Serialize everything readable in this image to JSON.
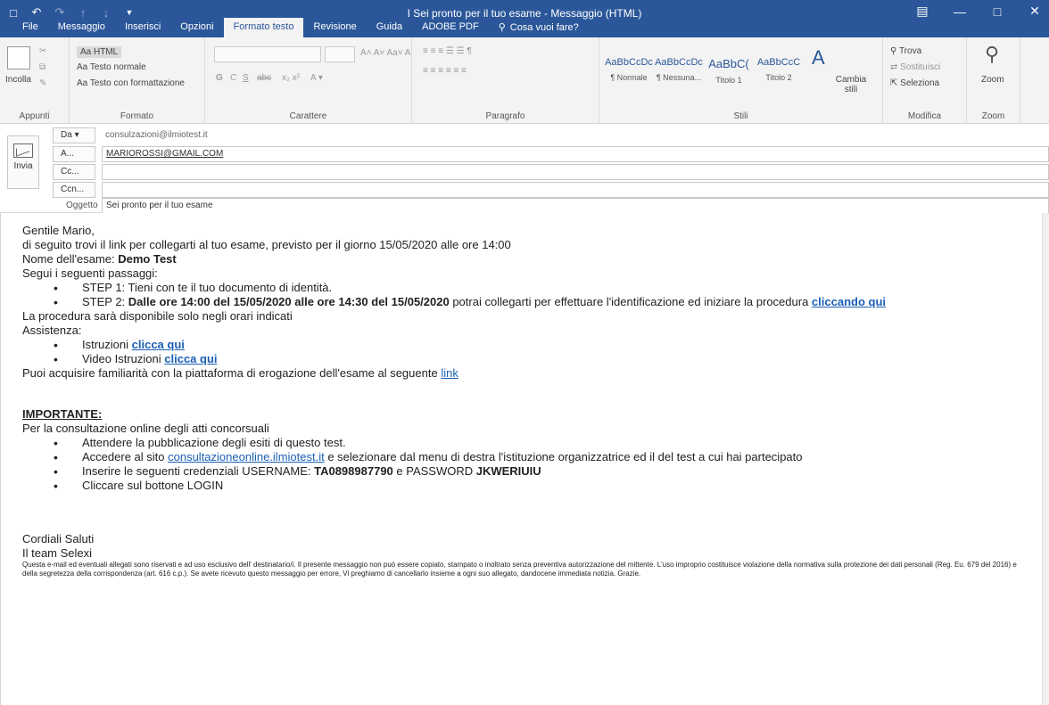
{
  "window": {
    "title": "I Sei pronto per il tuo esame - Messaggio (HTML)"
  },
  "ribbon": {
    "tabs": [
      "File",
      "Messaggio",
      "Inserisci",
      "Opzioni",
      "Formato testo",
      "Revisione",
      "Guida",
      "ADOBE PDF",
      "Cosa vuoi fare?"
    ],
    "active_tab": "Formato testo",
    "groups": {
      "appunti": {
        "label": "Appunti",
        "incolla": "Incolla"
      },
      "formato": {
        "label": "Formato",
        "html": "Aa HTML",
        "testo_normale": "Aa Testo normale",
        "testo_formattazione": "Aa Testo con formattazione"
      },
      "carattere": {
        "label": "Carattere"
      },
      "paragrafo": {
        "label": "Paragrafo"
      },
      "stili": {
        "label": "Stili",
        "items": [
          {
            "sample": "AaBbCcDc",
            "name": "¶ Normale"
          },
          {
            "sample": "AaBbCcDc",
            "name": "¶ Nessuna..."
          },
          {
            "sample": "AaBbC(",
            "name": "Titolo 1"
          },
          {
            "sample": "AaBbCcC",
            "name": "Titolo 2"
          }
        ],
        "cambia_stili": "Cambia stili"
      },
      "modifica": {
        "label": "Modifica",
        "trova": "Trova",
        "sostituisci": "Sostituisci",
        "seleziona": "Seleziona"
      },
      "zoom": {
        "label": "Zoom",
        "zoom_btn": "Zoom"
      }
    }
  },
  "header": {
    "send": "Invia",
    "da_label": "Da",
    "da_value": "consulzazioni@ilmiotest.it",
    "a_label": "A...",
    "a_value": "MARIOROSSI@GMAIL.COM",
    "cc_label": "Cc...",
    "ccn_label": "Ccn...",
    "subject_label": "Oggetto",
    "subject_value": "Sei pronto per il tuo esame"
  },
  "body": {
    "greeting": "Gentile Mario,",
    "intro": "di seguito trovi il link per collegarti al tuo esame, previsto per il giorno 15/05/2020 alle ore 14:00",
    "exam_label": "Nome dell'esame: ",
    "exam_name": "Demo Test",
    "steps_intro": "Segui i seguenti passaggi:",
    "step1": "STEP 1: Tieni con te il tuo documento di identità.",
    "step2_prefix": "STEP 2: ",
    "step2_bold": "Dalle ore 14:00 del 15/05/2020 alle ore 14:30 del 15/05/2020",
    "step2_rest": " potrai collegarti per effettuare l'identificazione ed iniziare la procedura ",
    "step2_link": "cliccando qui",
    "availability": "La procedura sarà disponibile solo negli orari indicati",
    "assistance": "Assistenza:",
    "istruzioni_label": "Istruzioni ",
    "istruzioni_link": "clicca qui",
    "video_label": "Video Istruzioni ",
    "video_link": "clicca qui",
    "familiarity": "Puoi acquisire familiarità con la piattaforma di erogazione dell'esame al seguente ",
    "familiarity_link": "link",
    "important": "IMPORTANTE:",
    "consult_intro": "Per la consultazione online degli atti concorsuali",
    "bullet1": "Attendere la pubblicazione degli esiti di questo test.",
    "bullet2_prefix": "Accedere al sito ",
    "bullet2_link": "consultazioneonline.ilmiotest.it",
    "bullet2_rest": " e selezionare dal menu di destra l'istituzione organizzatrice ed il del test a cui hai partecipato",
    "bullet3_prefix": "Inserire le seguenti credenziali USERNAME: ",
    "username": "TA0898987790",
    "bullet3_mid": " e PASSWORD ",
    "password": "JKWERIUIU",
    "bullet4": "Cliccare sul bottone LOGIN",
    "closing": "Cordiali Saluti",
    "team": "Il team Selexi",
    "disclaimer": "Questa e-mail ed eventuali allegati sono riservati e ad uso esclusivo dell' destinatario/i. Il presente messaggio non può essere copiato, stampato o inoltrato senza preventiva autorizzazione del mittente. L'uso improprio costituisce violazione della normativa sulla protezione dei dati personali (Reg. Eu. 679 del 2016) e della segretezza della corrispondenza (art. 616 c.p.). Se avete ricevuto questo messaggio per errore, Vi preghiamo di cancellarlo insieme a ogni suo allegato, dandocene immediata notizia. Grazie."
  }
}
